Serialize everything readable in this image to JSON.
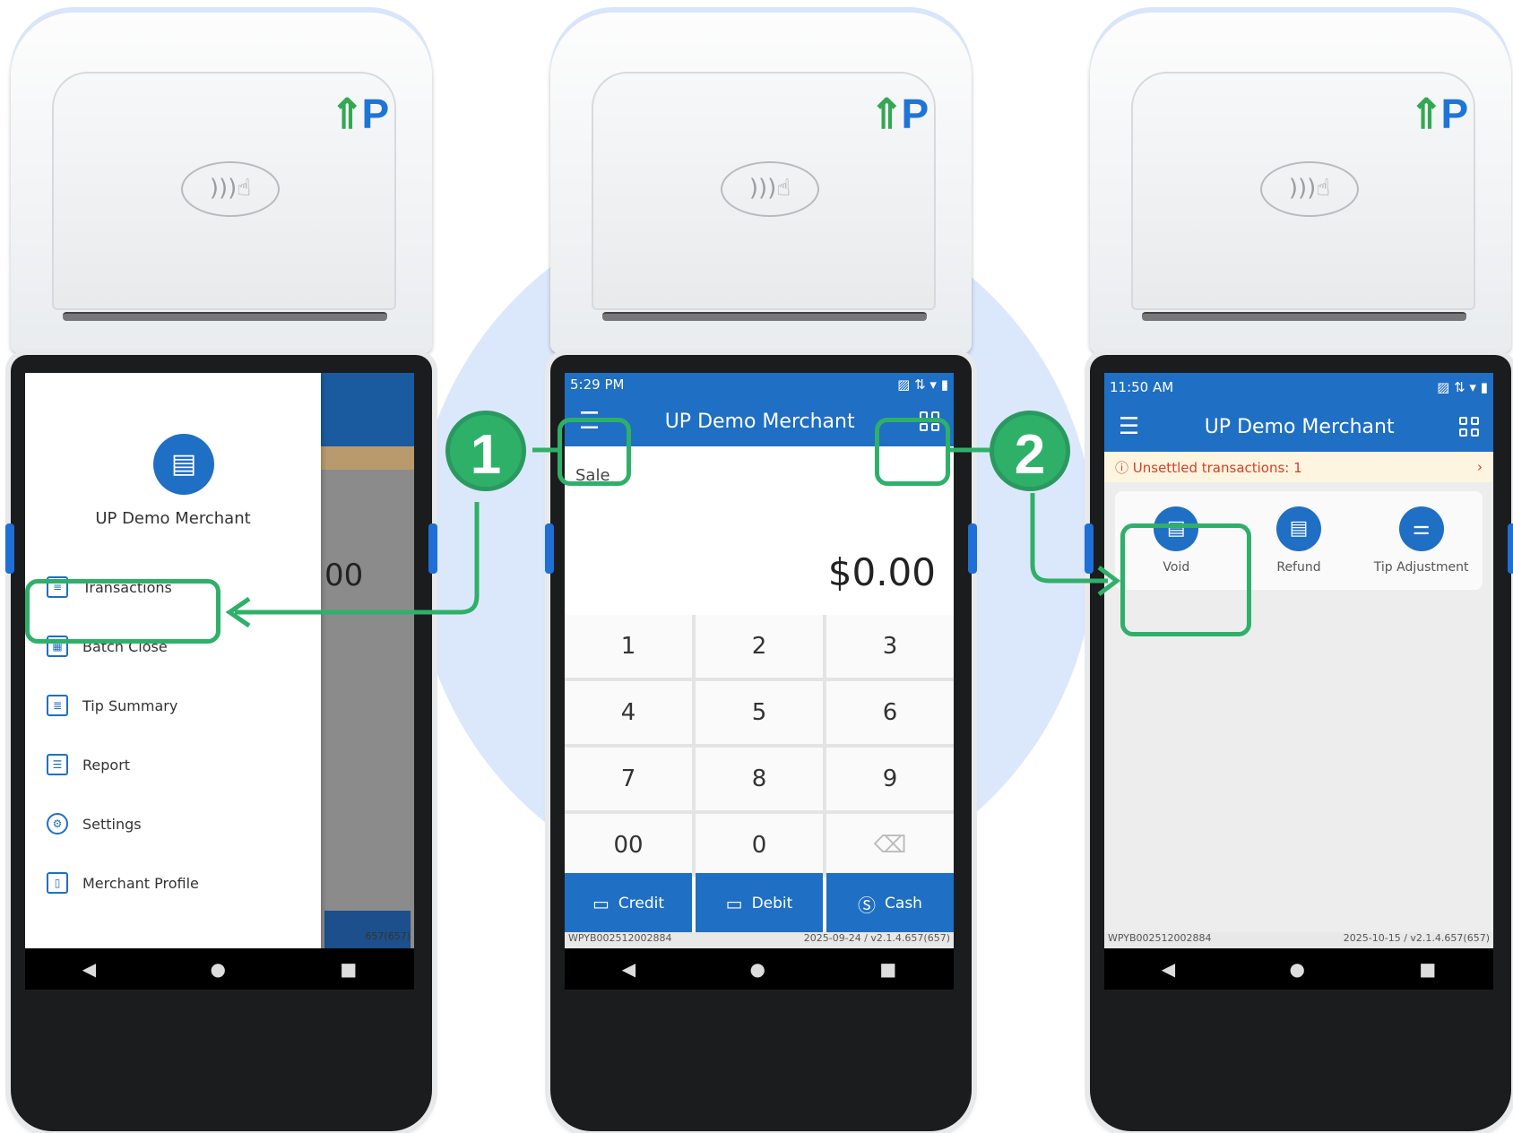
{
  "colors": {
    "accent": "#1f6fc4",
    "annotation": "#2fb069",
    "warning": "#d6402a"
  },
  "device": {
    "logo_text": "P"
  },
  "steps": [
    "1",
    "2"
  ],
  "screen1": {
    "merchant": "UP Demo Merchant",
    "menu": [
      {
        "label": "Transactions",
        "icon": "receipt-icon"
      },
      {
        "label": "Batch Close",
        "icon": "batch-icon"
      },
      {
        "label": "Tip Summary",
        "icon": "tip-summary-icon"
      },
      {
        "label": "Report",
        "icon": "report-icon"
      },
      {
        "label": "Settings",
        "icon": "gear-icon"
      },
      {
        "label": "Merchant Profile",
        "icon": "document-icon"
      }
    ],
    "behind_footer": "657(657)",
    "behind_amount": "00"
  },
  "screen2": {
    "time": "5:29 PM",
    "title": "UP Demo Merchant",
    "sale_label": "Sale",
    "amount": "$0.00",
    "keys": [
      "1",
      "2",
      "3",
      "4",
      "5",
      "6",
      "7",
      "8",
      "9",
      "00",
      "0",
      "⌫"
    ],
    "pay_buttons": [
      {
        "label": "Credit",
        "icon": "card-icon"
      },
      {
        "label": "Debit",
        "icon": "card-icon"
      },
      {
        "label": "Cash",
        "icon": "dollar-icon"
      }
    ],
    "serial": "WPYB002512002884",
    "version": "2025-09-24 / v2.1.4.657(657)"
  },
  "screen3": {
    "time": "11:50 AM",
    "title": "UP Demo Merchant",
    "warning": "Unsettled transactions: 1",
    "actions": [
      {
        "label": "Void",
        "icon": "void-icon"
      },
      {
        "label": "Refund",
        "icon": "refund-icon"
      },
      {
        "label": "Tip Adjustment",
        "icon": "sliders-icon"
      }
    ],
    "serial": "WPYB002512002884",
    "version": "2025-10-15 / v2.1.4.657(657)"
  }
}
